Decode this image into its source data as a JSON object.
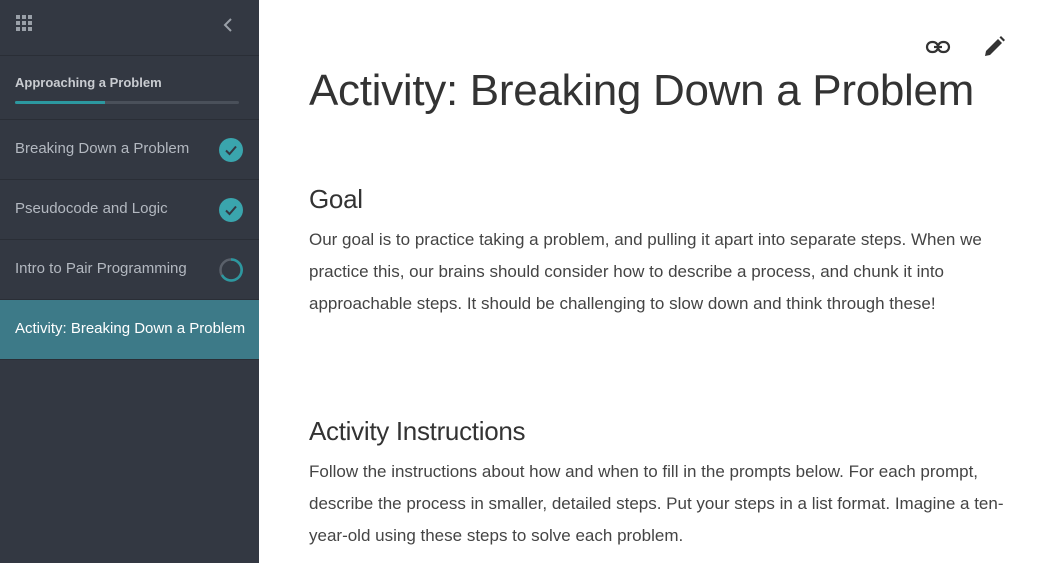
{
  "sidebar": {
    "section_title": "Approaching a Problem",
    "progress": 0.4,
    "items": [
      {
        "label": "Breaking Down a Problem",
        "status": "complete"
      },
      {
        "label": "Pseudocode and Logic",
        "status": "complete"
      },
      {
        "label": "Intro to Pair Programming",
        "status": "in-progress"
      },
      {
        "label": "Activity: Breaking Down a Problem",
        "status": "active"
      }
    ]
  },
  "main": {
    "title": "Activity: Breaking Down a Problem",
    "sections": [
      {
        "heading": "Goal",
        "body": "Our goal is to practice taking a problem, and pulling it apart into separate steps. When we practice this, our brains should consider how to describe a process, and chunk it into approachable steps. It should be challenging to slow down and think through these!"
      },
      {
        "heading": "Activity Instructions",
        "body": "Follow the instructions about how and when to fill in the prompts below. For each prompt, describe the process in smaller, detailed steps. Put your steps in a list format. Imagine a ten-year-old using these steps to solve each problem."
      }
    ]
  },
  "icons": {
    "apps": "grid-apps-icon",
    "collapse": "chevron-left-icon",
    "complete": "check-circle-icon",
    "in_progress": "progress-ring-icon",
    "link": "link-icon",
    "edit": "pencil-icon"
  },
  "colors": {
    "sidebar_bg": "#333842",
    "active_item_bg": "#3d7a88",
    "accent": "#2c98a0",
    "text_dark": "#333333"
  }
}
